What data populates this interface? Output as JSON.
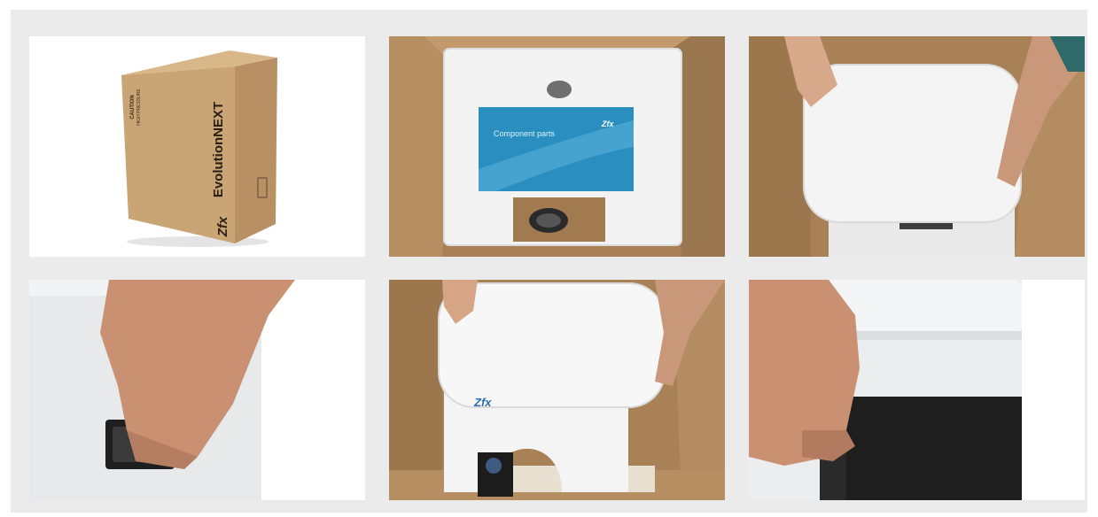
{
  "gallery": {
    "photos": [
      {
        "box_label": "EvolutionNEXT",
        "box_logo": "Zfx",
        "box_caution": "CAUTION",
        "box_caution_sub": "HIGH PRESSURE"
      },
      {
        "package_label": "Component parts",
        "package_logo": "Zfx"
      },
      {},
      {},
      {
        "device_logo": "Zfx"
      },
      {}
    ]
  }
}
